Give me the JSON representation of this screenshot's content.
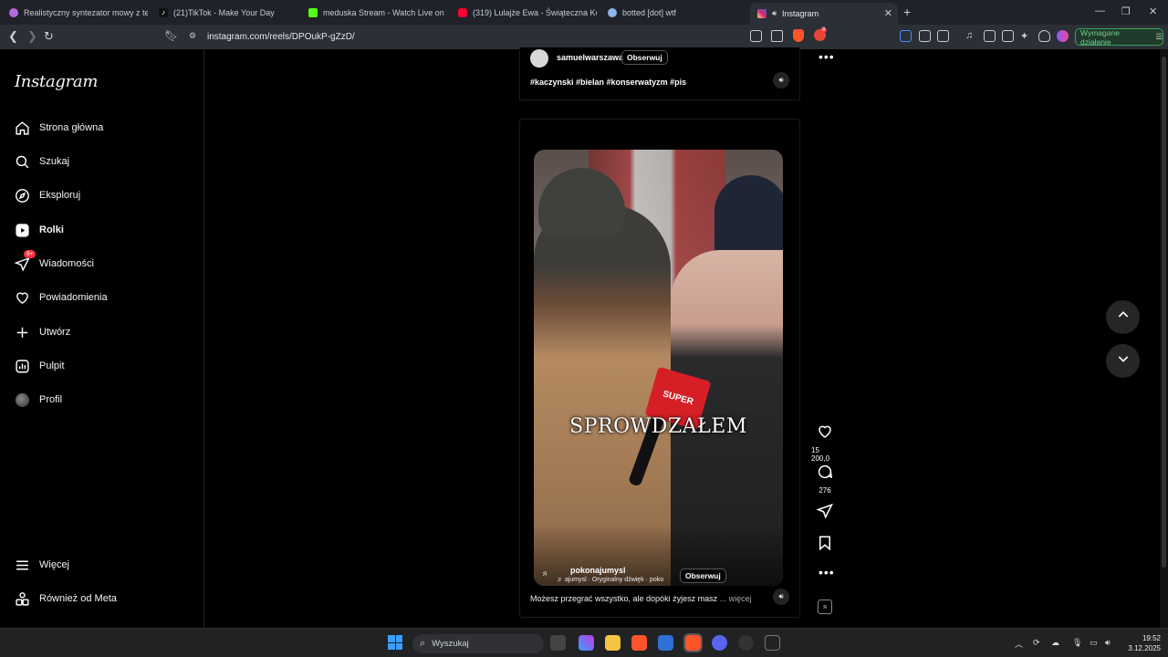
{
  "browser": {
    "tabs": [
      {
        "title": "Realistyczny syntezator mowy z tekst",
        "color": "#b56be0"
      },
      {
        "title": "(21)TikTok - Make Your Day",
        "color": "#ffffff"
      },
      {
        "title": "meduska Stream - Watch Live on Kic",
        "color": "#53fc18"
      },
      {
        "title": "(319) Lulajże Ewa - Świąteczna Kołys",
        "color": "#ff0033"
      },
      {
        "title": "botted [dot] wtf",
        "color": "#8fb4e8"
      },
      {
        "title": "Instagram",
        "color": "#e1306c"
      }
    ],
    "url": "instagram.com/reels/DPOukP-gZzD/",
    "required_action": "Wymagane działanie",
    "shield_badge": "8"
  },
  "sidebar": {
    "logo": "Instagram",
    "items": [
      {
        "label": "Strona główna",
        "icon": "home-icon"
      },
      {
        "label": "Szukaj",
        "icon": "search-icon"
      },
      {
        "label": "Eksploruj",
        "icon": "compass-icon"
      },
      {
        "label": "Rolki",
        "icon": "reels-icon"
      },
      {
        "label": "Wiadomości",
        "icon": "messages-icon",
        "badge": "9+"
      },
      {
        "label": "Powiadomienia",
        "icon": "heart-icon"
      },
      {
        "label": "Utwórz",
        "icon": "plus-icon"
      },
      {
        "label": "Pulpit",
        "icon": "dashboard-icon"
      },
      {
        "label": "Profil",
        "icon": "avatar"
      }
    ],
    "more": "Więcej",
    "meta": "Również od Meta"
  },
  "prev_post": {
    "username": "samuelwarszawa",
    "follow": "Obserwuj",
    "tags": "#kaczynski #bielan #konserwatyzm #pis"
  },
  "reel": {
    "overlay_text": "SPROWDZAŁEM",
    "mic_brand": "SUPER",
    "username": "pokonajumysl",
    "follow": "Obserwuj",
    "audio": "ajumysl · Oryginalny dźwięk · poko",
    "description": "Możesz przegrać wszystko, ale dopóki żyjesz masz",
    "more": "... więcej",
    "likes": "15 200,0",
    "comments": "276",
    "logo_mark": "ᴙ"
  },
  "taskbar": {
    "search_placeholder": "Wyszukaj",
    "time": "19:52",
    "date": "3.12.2025"
  }
}
